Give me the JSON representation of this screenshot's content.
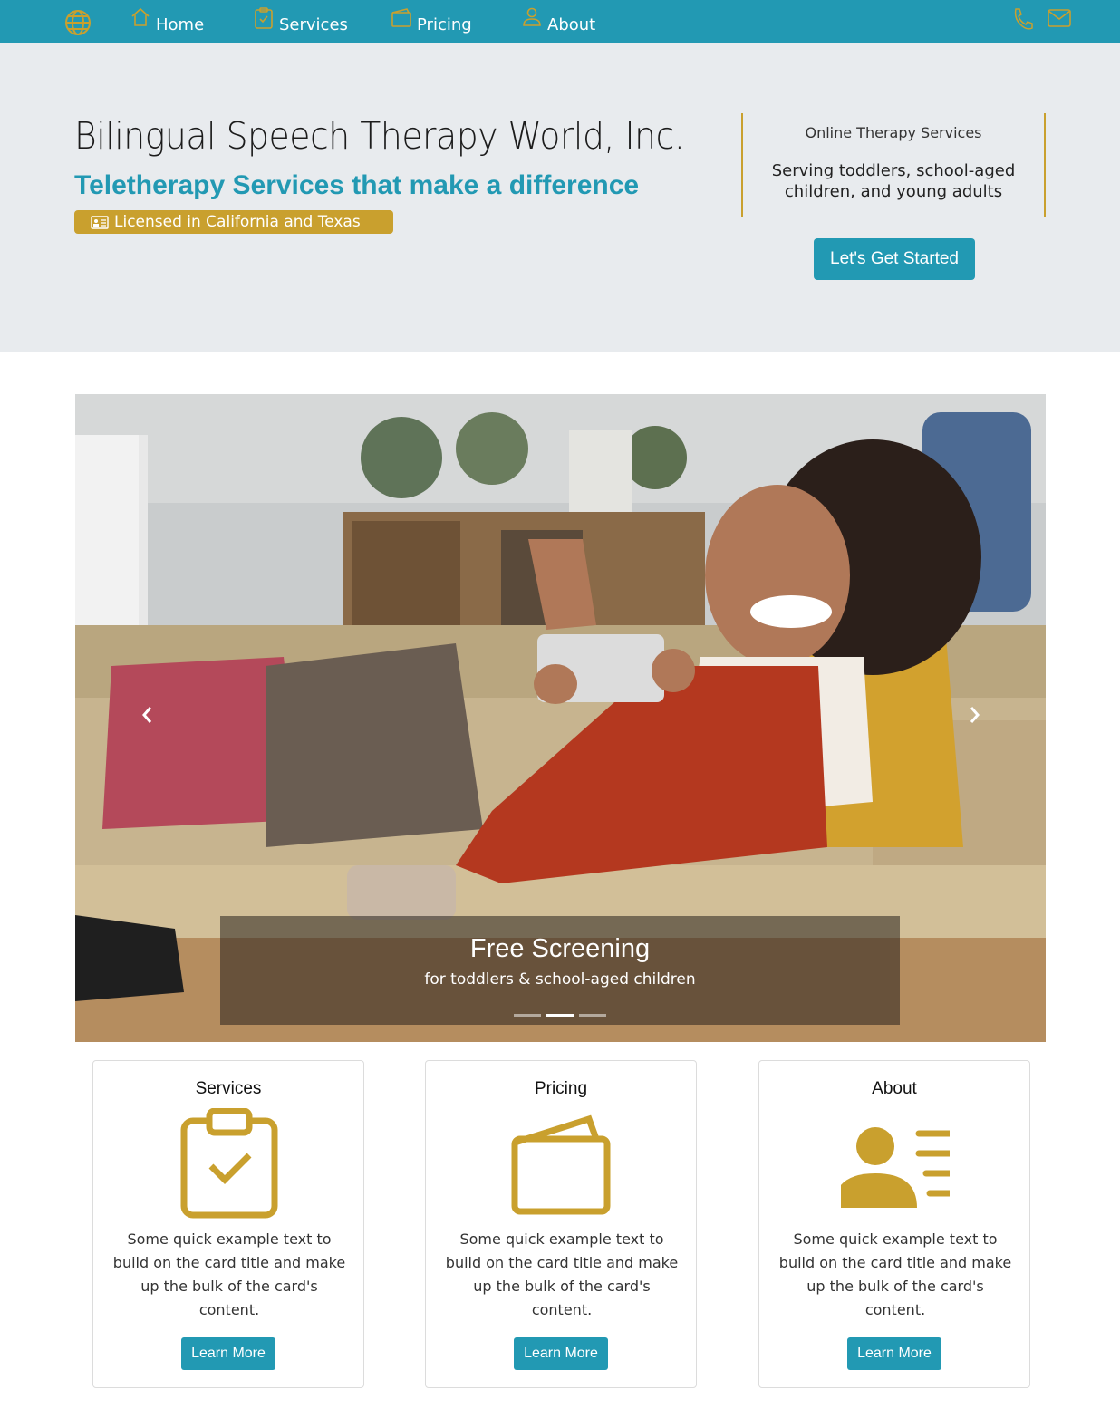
{
  "nav": {
    "logo_icon": "globe-icon",
    "items": [
      {
        "label": "Home",
        "icon": "house-icon"
      },
      {
        "label": "Services",
        "icon": "clipboard-check-icon"
      },
      {
        "label": "Pricing",
        "icon": "wallet-icon"
      },
      {
        "label": "About",
        "icon": "person-icon"
      }
    ],
    "right_icons": [
      "phone-icon",
      "envelope-icon"
    ]
  },
  "hero": {
    "title": "Bilingual Speech Therapy World, Inc.",
    "subtitle": "Teletherapy Services that make a difference",
    "badge": "Licensed in California and Texas",
    "info_heading": "Online Therapy Services",
    "info_text": "Serving toddlers, school-aged children, and young adults",
    "cta": "Let's Get Started"
  },
  "carousel": {
    "caption_title": "Free Screening",
    "caption_text": "for toddlers & school-aged children",
    "indicator_count": 3,
    "active_index": 1
  },
  "cards": [
    {
      "title": "Services",
      "icon": "clipboard-check-icon",
      "text": "Some quick example text to build on the card title and make up the bulk of the card's content.",
      "button": "Learn More"
    },
    {
      "title": "Pricing",
      "icon": "wallet-icon",
      "text": "Some quick example text to build on the card title and make up the bulk of the card's content.",
      "button": "Learn More"
    },
    {
      "title": "About",
      "icon": "person-id-icon",
      "text": "Some quick example text to build on the card title and make up the bulk of the card's content.",
      "button": "Learn More"
    }
  ],
  "colors": {
    "primary": "#2299b3",
    "accent": "#c9a02e",
    "hero_bg": "#e8ebee"
  }
}
